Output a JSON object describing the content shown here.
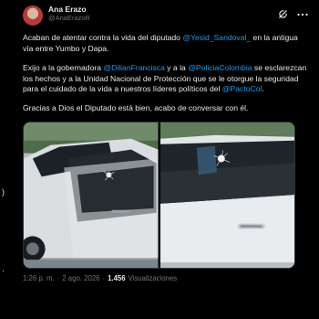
{
  "left_strip": {
    "glyph_top": ")",
    "glyph_bottom": "·"
  },
  "author": {
    "display_name": "Ana Erazo",
    "handle": "@AnaErazoR"
  },
  "tweet": {
    "p1_before": "Acaban de atentar contra la vida del diputado ",
    "p1_mention": "@Yesid_Sandoval_",
    "p1_after": " en la antigua vía entre Yumbo y Dapa.",
    "p2_a": "Exijo a la gobernadora ",
    "p2_mention1": "@DilianFrancisca",
    "p2_b": " y a la ",
    "p2_mention2": "@PoliciaColombia",
    "p2_c": " se esclarezcan los hechos y a la Unidad Nacional de Protección que se le otorgue la seguridad para el cuidado de la vida a nuestros líderes políticos del ",
    "p2_mention3": "@PactoCol",
    "p2_d": ".",
    "p3": "Gracias a Dios el Diputado está bien, acabo de conversar con él."
  },
  "meta": {
    "time": "1:26 p. m.",
    "sep1": "·",
    "date": "2 ago. 2026",
    "sep2": "·",
    "views_count": "1.456",
    "views_label": "Visualizaciones"
  },
  "icons": {
    "grok": "grok-icon",
    "more": "more-icon"
  },
  "colors": {
    "background": "#000000",
    "text": "#e7e9ea",
    "secondary": "#71767b",
    "link": "#1d9bf0",
    "border": "#2f3336"
  }
}
